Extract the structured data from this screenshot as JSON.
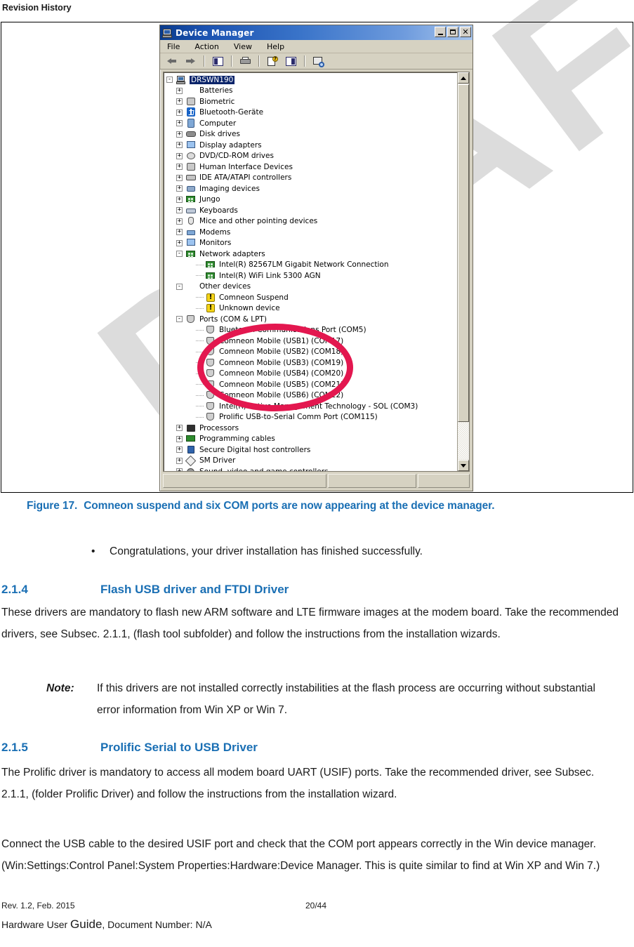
{
  "document": {
    "header": "Revision History"
  },
  "figure": {
    "number": "Figure 17.",
    "caption": "Comneon suspend and six COM ports are now appearing at the device manager.",
    "annotation_color": "#e3174f"
  },
  "device_manager": {
    "title": "Device Manager",
    "title_icon": "computer-icon",
    "window_buttons": [
      {
        "name": "minimize",
        "glyph": "_"
      },
      {
        "name": "maximize",
        "glyph": "□"
      },
      {
        "name": "close",
        "glyph": "✕"
      }
    ],
    "menu": [
      "File",
      "Action",
      "View",
      "Help"
    ],
    "toolbar": [
      "back-arrow-icon",
      "forward-arrow-icon",
      "show-hide-console-tree-icon",
      "print-icon",
      "properties-icon",
      "show-hide-action-pane-icon",
      "scan-for-hardware-changes-icon"
    ],
    "tree": [
      {
        "label": "DRSWN190",
        "indent": 0,
        "expander": "-",
        "icon": "computer-icon",
        "selected": true
      },
      {
        "label": "Batteries",
        "indent": 1,
        "expander": "+",
        "icon": "battery-icon"
      },
      {
        "label": "Biometric",
        "indent": 1,
        "expander": "+",
        "icon": "biometric-icon"
      },
      {
        "label": "Bluetooth-Geräte",
        "indent": 1,
        "expander": "+",
        "icon": "bluetooth-icon"
      },
      {
        "label": "Computer",
        "indent": 1,
        "expander": "+",
        "icon": "computer-node-icon"
      },
      {
        "label": "Disk drives",
        "indent": 1,
        "expander": "+",
        "icon": "disk-drive-icon"
      },
      {
        "label": "Display adapters",
        "indent": 1,
        "expander": "+",
        "icon": "display-adapter-icon"
      },
      {
        "label": "DVD/CD-ROM drives",
        "indent": 1,
        "expander": "+",
        "icon": "dvd-drive-icon"
      },
      {
        "label": "Human Interface Devices",
        "indent": 1,
        "expander": "+",
        "icon": "hid-icon"
      },
      {
        "label": "IDE ATA/ATAPI controllers",
        "indent": 1,
        "expander": "+",
        "icon": "ide-controller-icon"
      },
      {
        "label": "Imaging devices",
        "indent": 1,
        "expander": "+",
        "icon": "imaging-device-icon"
      },
      {
        "label": "Jungo",
        "indent": 1,
        "expander": "+",
        "icon": "network-icon"
      },
      {
        "label": "Keyboards",
        "indent": 1,
        "expander": "+",
        "icon": "keyboard-icon"
      },
      {
        "label": "Mice and other pointing devices",
        "indent": 1,
        "expander": "+",
        "icon": "mouse-icon"
      },
      {
        "label": "Modems",
        "indent": 1,
        "expander": "+",
        "icon": "modem-icon"
      },
      {
        "label": "Monitors",
        "indent": 1,
        "expander": "+",
        "icon": "monitor-icon"
      },
      {
        "label": "Network adapters",
        "indent": 1,
        "expander": "-",
        "icon": "network-icon"
      },
      {
        "label": "Intel(R) 82567LM Gigabit Network Connection",
        "indent": 2,
        "expander": "",
        "icon": "network-icon"
      },
      {
        "label": "Intel(R) WiFi Link 5300 AGN",
        "indent": 2,
        "expander": "",
        "icon": "network-icon"
      },
      {
        "label": "Other devices",
        "indent": 1,
        "expander": "-",
        "icon": "question-mark-icon"
      },
      {
        "label": "Comneon Suspend",
        "indent": 2,
        "expander": "",
        "icon": "warning-device-icon"
      },
      {
        "label": "Unknown device",
        "indent": 2,
        "expander": "",
        "icon": "warning-device-icon"
      },
      {
        "label": "Ports (COM & LPT)",
        "indent": 1,
        "expander": "-",
        "icon": "port-icon"
      },
      {
        "label": "Bluetooth Communications Port (COM5)",
        "indent": 2,
        "expander": "",
        "icon": "port-icon"
      },
      {
        "label": "Comneon Mobile (USB1) (COM17)",
        "indent": 2,
        "expander": "",
        "icon": "port-icon"
      },
      {
        "label": "Comneon Mobile (USB2) (COM18)",
        "indent": 2,
        "expander": "",
        "icon": "port-icon"
      },
      {
        "label": "Comneon Mobile (USB3) (COM19)",
        "indent": 2,
        "expander": "",
        "icon": "port-icon"
      },
      {
        "label": "Comneon Mobile (USB4) (COM20)",
        "indent": 2,
        "expander": "",
        "icon": "port-icon"
      },
      {
        "label": "Comneon Mobile (USB5) (COM21)",
        "indent": 2,
        "expander": "",
        "icon": "port-icon"
      },
      {
        "label": "Comneon Mobile (USB6) (COM22)",
        "indent": 2,
        "expander": "",
        "icon": "port-icon"
      },
      {
        "label": "Intel(R) Active Management Technology - SOL (COM3)",
        "indent": 2,
        "expander": "",
        "icon": "port-icon"
      },
      {
        "label": "Prolific USB-to-Serial Comm Port (COM115)",
        "indent": 2,
        "expander": "",
        "icon": "port-icon"
      },
      {
        "label": "Processors",
        "indent": 1,
        "expander": "+",
        "icon": "processor-icon"
      },
      {
        "label": "Programming cables",
        "indent": 1,
        "expander": "+",
        "icon": "programming-cable-icon"
      },
      {
        "label": "Secure Digital host controllers",
        "indent": 1,
        "expander": "+",
        "icon": "sd-host-icon"
      },
      {
        "label": "SM Driver",
        "indent": 1,
        "expander": "+",
        "icon": "sm-driver-icon"
      },
      {
        "label": "Sound, video and game controllers",
        "indent": 1,
        "expander": "+",
        "icon": "sound-controller-icon"
      }
    ]
  },
  "bullet": {
    "marker": "•",
    "text": "Congratulations, your driver installation has finished successfully."
  },
  "sections": [
    {
      "number": "2.1.4",
      "title": "Flash USB driver and FTDI Driver",
      "body": "These drivers are mandatory to flash new ARM software and LTE firmware images at the modem board. Take the recommended drivers, see Subsec. 2.1.1, (flash tool subfolder) and follow the instructions from the installation wizards."
    },
    {
      "number": "2.1.5",
      "title": "Prolific Serial to USB Driver",
      "body": "The Prolific driver is mandatory to access all modem board UART (USIF) ports. Take the recommended driver, see Subsec. 2.1.1, (folder Prolific Driver) and follow the instructions from the installation wizard.",
      "body2": "Connect the USB cable to the desired USIF port and check that the COM port appears correctly in the Win device manager. (Win:Settings:Control Panel:System Properties:Hardware:Device Manager. This is quite similar to find at Win XP and Win 7.)"
    }
  ],
  "note": {
    "label": "Note:",
    "text": "If this drivers are not installed correctly instabilities at the flash process are occurring without substantial error information from Win XP or Win 7."
  },
  "footer": {
    "revision": "Rev. 1.2, Feb. 2015",
    "page": "20/44",
    "doc_prefix": "Hardware User ",
    "doc_big": "Guide",
    "doc_suffix": ", Document Number: N/A"
  },
  "watermark": {
    "text": "DRAFT"
  },
  "colors": {
    "heading_blue": "#1a6fb4",
    "annotation_red": "#e3174f",
    "watermark_gray": "#d7d7d7"
  }
}
